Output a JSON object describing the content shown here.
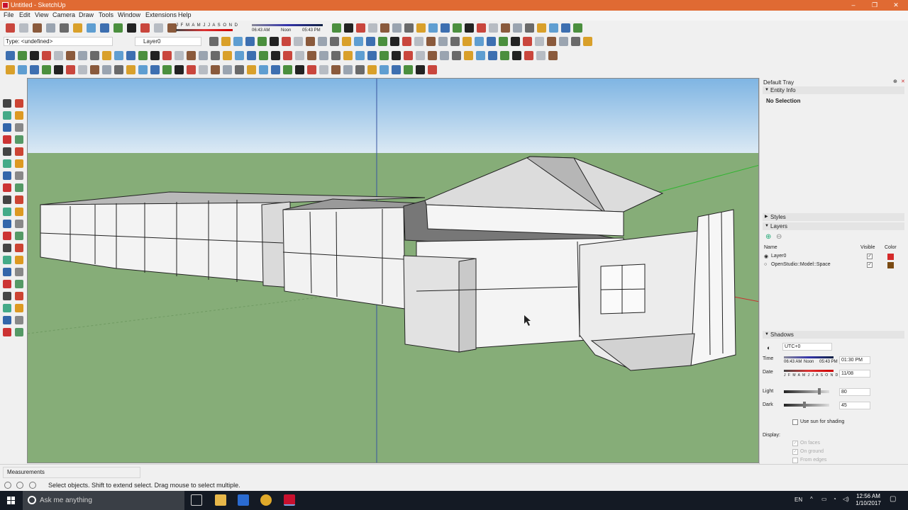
{
  "window": {
    "title": "Untitled - SketchUp",
    "controls": [
      "–",
      "❐",
      "✕"
    ]
  },
  "menu": [
    "File",
    "Edit",
    "View",
    "Camera",
    "Draw",
    "Tools",
    "Window",
    "Extensions",
    "Help"
  ],
  "toolbar": {
    "type_field": "Type: <undefined>",
    "layer_select": "Layer0",
    "shadow_months": "J F M A M J J A S O N D",
    "shadow_time_left": "06:43 AM",
    "shadow_time_noon": "Noon",
    "shadow_time_right": "05:43 PM"
  },
  "tray": {
    "title": "Default Tray",
    "entity_info": {
      "header": "Entity Info",
      "selection": "No Selection"
    },
    "styles_header": "Styles",
    "layers": {
      "header": "Layers",
      "columns": {
        "name": "Name",
        "visible": "Visible",
        "color": "Color"
      },
      "rows": [
        {
          "name": "Layer0",
          "visible": true,
          "color": "#d42a2a"
        },
        {
          "name": "OpenStudio::Model::Space",
          "visible": true,
          "color": "#7a4a12"
        }
      ]
    },
    "shadows": {
      "header": "Shadows",
      "timezone": "UTC+0",
      "time_label": "Time",
      "time_left": "06:43 AM",
      "time_noon": "Noon",
      "time_right": "05:43 PM",
      "time_value": "01:30 PM",
      "date_label": "Date",
      "date_months": "J F M A M J J A S O N D",
      "date_value": "11/08",
      "light_label": "Light",
      "light_value": "80",
      "light_level": 80,
      "dark_label": "Dark",
      "dark_value": "45",
      "dark_level": 45,
      "use_sun": "Use sun for shading",
      "display_label": "Display:",
      "on_faces": "On faces",
      "on_ground": "On ground",
      "from_edges": "From edges"
    }
  },
  "measurements": {
    "label": "Measurements"
  },
  "status": {
    "hint": "Select objects. Shift to extend select. Drag mouse to select multiple."
  },
  "taskbar": {
    "search_placeholder": "Ask me anything",
    "language": "EN",
    "time": "12:56 AM",
    "date": "1/10/2017"
  },
  "colors": {
    "title_bar": "#e06a33",
    "sky_top": "#7fb5e3",
    "sky_bottom": "#dbe9f4",
    "ground": "#86ad78",
    "taskbar": "#141a24"
  }
}
